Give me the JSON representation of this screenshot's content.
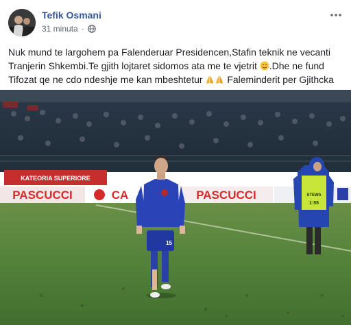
{
  "post": {
    "author": "Tefik Osmani",
    "time": "31 minuta",
    "separator": "·",
    "privacy_icon": "globe-icon",
    "text": {
      "part1": "Nuk mund te largohem pa Falenderuar Presidencen,Stafin teknik ne vecanti Tranjerin Shkembi.Te gjith lojtaret sidomos ata me te vjetrit ",
      "part2": ".Dhe ne fund Tifozat qe ne cdo ndeshje me kan mbeshtetur",
      "part3": " Faleminderit per Gjithcka"
    },
    "emojis": [
      "smiling-face-emoji",
      "folded-hands-emoji",
      "folded-hands-emoji"
    ]
  },
  "photo": {
    "banners": {
      "kategoria": "KATEORIA SUPERIORE",
      "ad1": "PASCUCCI",
      "ad2": "CA",
      "ad3": "PASCUCCI"
    },
    "player_number": "15",
    "steward_vest": "STEWA",
    "steward_number": "1:55"
  },
  "colors": {
    "link": "#385898",
    "meta": "#616770",
    "text": "#1c1e21",
    "pitch": "#4f7e35",
    "kit": "#2a3fa8",
    "vest": "#c8e63a"
  }
}
